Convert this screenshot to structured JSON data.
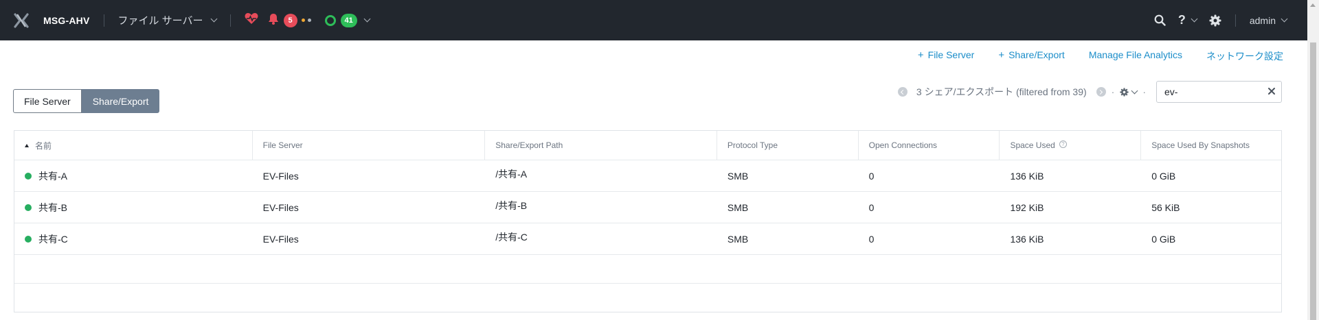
{
  "topbar": {
    "cluster_name": "MSG-AHV",
    "page_menu_label": "ファイル サーバー",
    "alerts_count": "5",
    "tasks_count": "41",
    "user_label": "admin",
    "colors": {
      "bar_bg": "#22272e",
      "alert": "#e74c5a",
      "ok": "#2ebd59",
      "health": "#e74c5a",
      "warn_dot": "#f0a732"
    }
  },
  "actions": [
    {
      "label": "File Server",
      "has_plus": true
    },
    {
      "label": "Share/Export",
      "has_plus": true
    },
    {
      "label": "Manage File Analytics",
      "has_plus": false
    },
    {
      "label": "ネットワーク設定",
      "has_plus": false
    }
  ],
  "view_toggle": {
    "options": [
      "File Server",
      "Share/Export"
    ],
    "selected": "Share/Export"
  },
  "pager": {
    "summary": "3 シェア/エクスポート (filtered from 39)",
    "separator": "·"
  },
  "search": {
    "value": "ev-"
  },
  "table": {
    "columns": [
      "名前",
      "File Server",
      "Share/Export Path",
      "Protocol Type",
      "Open Connections",
      "Space Used",
      "Space Used By Snapshots"
    ],
    "sorted_column": "名前",
    "rows": [
      {
        "name": "共有-A",
        "file_server": "EV-Files",
        "path": "/共有-A",
        "protocol": "SMB",
        "connections": "0",
        "space_used": "136 KiB",
        "snapshots": "0 GiB",
        "status": "green"
      },
      {
        "name": "共有-B",
        "file_server": "EV-Files",
        "path": "/共有-B",
        "protocol": "SMB",
        "connections": "0",
        "space_used": "192 KiB",
        "snapshots": "56 KiB",
        "status": "green"
      },
      {
        "name": "共有-C",
        "file_server": "EV-Files",
        "path": "/共有-C",
        "protocol": "SMB",
        "connections": "0",
        "space_used": "136 KiB",
        "snapshots": "0 GiB",
        "status": "green"
      }
    ]
  },
  "accent_color": "#1b8dc9"
}
